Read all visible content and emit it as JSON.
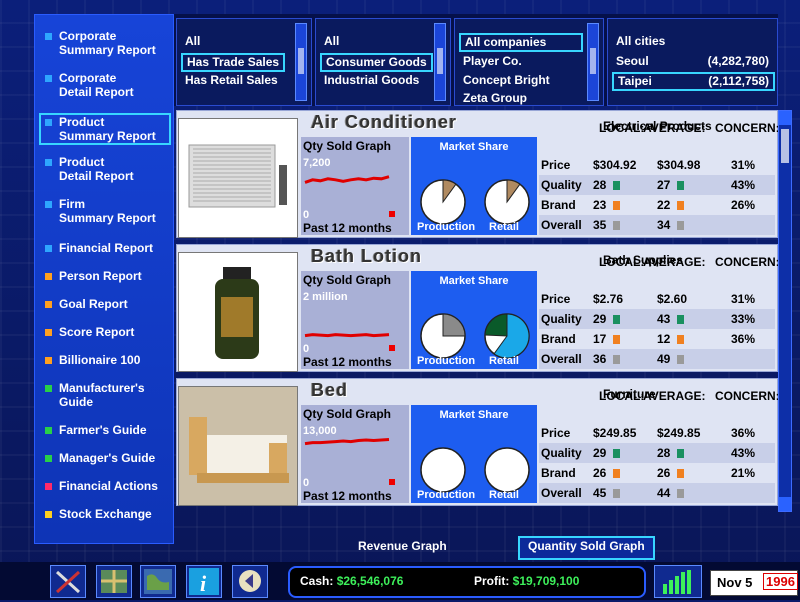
{
  "sidebar": {
    "items": [
      {
        "label": "Corporate\nSummary Report",
        "color": "#2ea6ff"
      },
      {
        "label": "Corporate\nDetail Report",
        "color": "#2ea6ff"
      },
      {
        "label": "Product\nSummary Report",
        "color": "#2ea6ff",
        "selected": true
      },
      {
        "label": "Product\nDetail Report",
        "color": "#2ea6ff"
      },
      {
        "label": "Firm\nSummary Report",
        "color": "#2ea6ff"
      },
      {
        "label": "Financial Report",
        "color": "#2ea6ff"
      },
      {
        "label": "Person Report",
        "color": "#ffa020"
      },
      {
        "label": "Goal Report",
        "color": "#ffa020"
      },
      {
        "label": "Score Report",
        "color": "#ffa020"
      },
      {
        "label": "Billionaire 100",
        "color": "#ffa020"
      },
      {
        "label": "Manufacturer's\nGuide",
        "color": "#28d048"
      },
      {
        "label": "Farmer's Guide",
        "color": "#28d048"
      },
      {
        "label": "Manager's Guide",
        "color": "#28d048"
      },
      {
        "label": "Financial Actions",
        "color": "#ff2a6a"
      },
      {
        "label": "Stock Exchange",
        "color": "#ffd020"
      }
    ]
  },
  "filters": {
    "sales": [
      "All",
      "Has Trade Sales",
      "Has Retail Sales"
    ],
    "goods": [
      "All",
      "Consumer Goods",
      "Industrial Goods"
    ],
    "companies": [
      "All companies",
      "Player Co.",
      "Concept Bright",
      "Zeta Group"
    ],
    "cities": [
      {
        "name": "All cities",
        "pop": ""
      },
      {
        "name": "Seoul",
        "pop": "(4,282,780)"
      },
      {
        "name": "Taipei",
        "pop": "(2,112,758)"
      }
    ]
  },
  "labels": {
    "qty_title": "Qty Sold Graph",
    "qty_foot": "Past 12 months",
    "market_share": "Market Share",
    "production": "Production",
    "retail": "Retail",
    "local": "LOCAL:",
    "average": "AVERAGE:",
    "concern": "CONCERN:",
    "price": "Price",
    "quality": "Quality",
    "brand": "Brand",
    "overall": "Overall",
    "zero": "0"
  },
  "products": [
    {
      "name": "Air Conditioner",
      "category": "Electrical Products",
      "qty_max": "7,200",
      "trend": [
        0.55,
        0.6,
        0.58,
        0.62,
        0.6,
        0.57,
        0.6,
        0.62,
        0.6,
        0.63,
        0.62,
        0.66
      ],
      "production_share": 0.1,
      "retail_share": 0.1,
      "price": {
        "local": "$304.92",
        "avg": "$304.98",
        "concern": "31%"
      },
      "quality": {
        "local": "28",
        "avg": "27",
        "concern": "43%",
        "color": "#1a9060"
      },
      "brand": {
        "local": "23",
        "avg": "22",
        "concern": "26%",
        "color": "#f08020"
      },
      "overall": {
        "local": "35",
        "avg": "34",
        "color": "#9a9a9a"
      }
    },
    {
      "name": "Bath Lotion",
      "category": "Bath Supplies",
      "qty_max": "2 million",
      "trend": [
        0.18,
        0.2,
        0.19,
        0.18,
        0.2,
        0.19,
        0.18,
        0.19,
        0.2,
        0.18,
        0.19,
        0.2
      ],
      "production_share": 0.25,
      "retail_share": 0.6,
      "price": {
        "local": "$2.76",
        "avg": "$2.60",
        "concern": "31%"
      },
      "quality": {
        "local": "29",
        "avg": "43",
        "concern": "33%",
        "color": "#1a9060"
      },
      "brand": {
        "local": "17",
        "avg": "12",
        "concern": "36%",
        "color": "#f08020"
      },
      "overall": {
        "local": "36",
        "avg": "49",
        "color": "#9a9a9a"
      }
    },
    {
      "name": "Bed",
      "category": "Furniture",
      "qty_max": "13,000",
      "trend": [
        0.68,
        0.7,
        0.7,
        0.71,
        0.72,
        0.73,
        0.72,
        0.74,
        0.75,
        0.74,
        0.75,
        0.76
      ],
      "production_share": 0.0,
      "retail_share": 0.0,
      "price": {
        "local": "$249.85",
        "avg": "$249.85",
        "concern": "36%"
      },
      "quality": {
        "local": "29",
        "avg": "28",
        "concern": "43%",
        "color": "#1a9060"
      },
      "brand": {
        "local": "26",
        "avg": "26",
        "concern": "21%",
        "color": "#f08020"
      },
      "overall": {
        "local": "45",
        "avg": "44",
        "color": "#9a9a9a"
      }
    }
  ],
  "graph_toggle": {
    "revenue": "Revenue Graph",
    "quantity": "Quantity Sold Graph"
  },
  "status": {
    "cash_label": "Cash:",
    "cash": "$26,546,076",
    "profit_label": "Profit:",
    "profit": "$19,709,100",
    "date": "Nov 5",
    "year": "1996"
  },
  "toolbar_icons": [
    "tools-icon",
    "map-tile-icon",
    "world-map-icon",
    "info-icon",
    "back-arrow-icon"
  ]
}
